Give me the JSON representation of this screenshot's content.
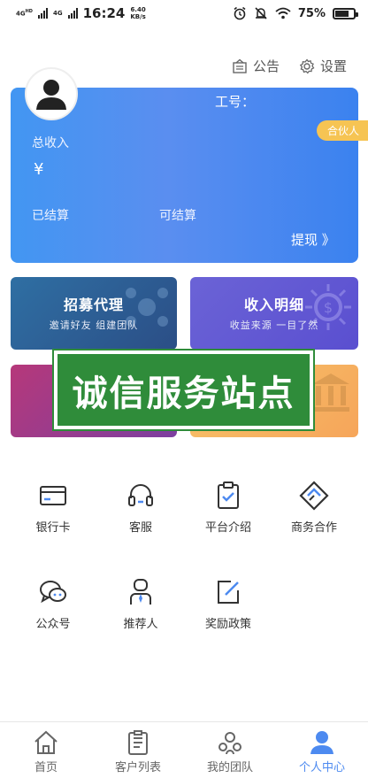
{
  "status_bar": {
    "net1": "4G",
    "net1_sup": "HD",
    "net2": "4G",
    "time": "16:24",
    "speed_value": "6.40",
    "speed_unit": "KB/s",
    "battery_pct": "75%",
    "battery_level": 0.75,
    "icons": [
      "alarm-icon",
      "mute-icon",
      "wifi-icon",
      "battery-icon"
    ]
  },
  "top_links": {
    "announcement": "公告",
    "settings": "设置"
  },
  "card": {
    "work_no_label": "工号：",
    "partner_badge": "合伙人",
    "total_income_label": "总收入",
    "currency_symbol": "¥",
    "settled_label": "已结算",
    "settleable_label": "可结算",
    "withdraw_label": "提现 》",
    "colors": {
      "start": "#4296f2",
      "end": "#3b82ef"
    }
  },
  "tiles": [
    {
      "title": "招募代理",
      "subtitle": "邀请好友  组建团队",
      "color_start": "#2f6fa3",
      "color_end": "#2b4e86"
    },
    {
      "title": "收入明细",
      "subtitle": "收益来源  一目了然",
      "color_start": "#6b63d6",
      "color_end": "#5a4fd0"
    },
    {
      "title": "",
      "subtitle": "",
      "color_start": "#b6387a",
      "color_end": "#7c3fa0"
    },
    {
      "title": "",
      "subtitle": "",
      "color_start": "#f7c46a",
      "color_end": "#f6a55a"
    }
  ],
  "banner": {
    "text": "诚信服务站点",
    "color": "#2f8c3a"
  },
  "grid": [
    {
      "label": "银行卡",
      "icon": "bank-card-icon"
    },
    {
      "label": "客服",
      "icon": "headset-icon"
    },
    {
      "label": "平台介绍",
      "icon": "clipboard-check-icon"
    },
    {
      "label": "商务合作",
      "icon": "handshake-icon"
    },
    {
      "label": "公众号",
      "icon": "chat-bubbles-icon"
    },
    {
      "label": "推荐人",
      "icon": "person-tie-icon"
    },
    {
      "label": "奖励政策",
      "icon": "edit-square-icon"
    }
  ],
  "bottom_nav": [
    {
      "label": "首页",
      "icon": "home-icon",
      "active": false
    },
    {
      "label": "客户列表",
      "icon": "list-document-icon",
      "active": false
    },
    {
      "label": "我的团队",
      "icon": "team-icon",
      "active": false
    },
    {
      "label": "个人中心",
      "icon": "user-icon",
      "active": true
    }
  ],
  "accent_color": "#4d8af0"
}
